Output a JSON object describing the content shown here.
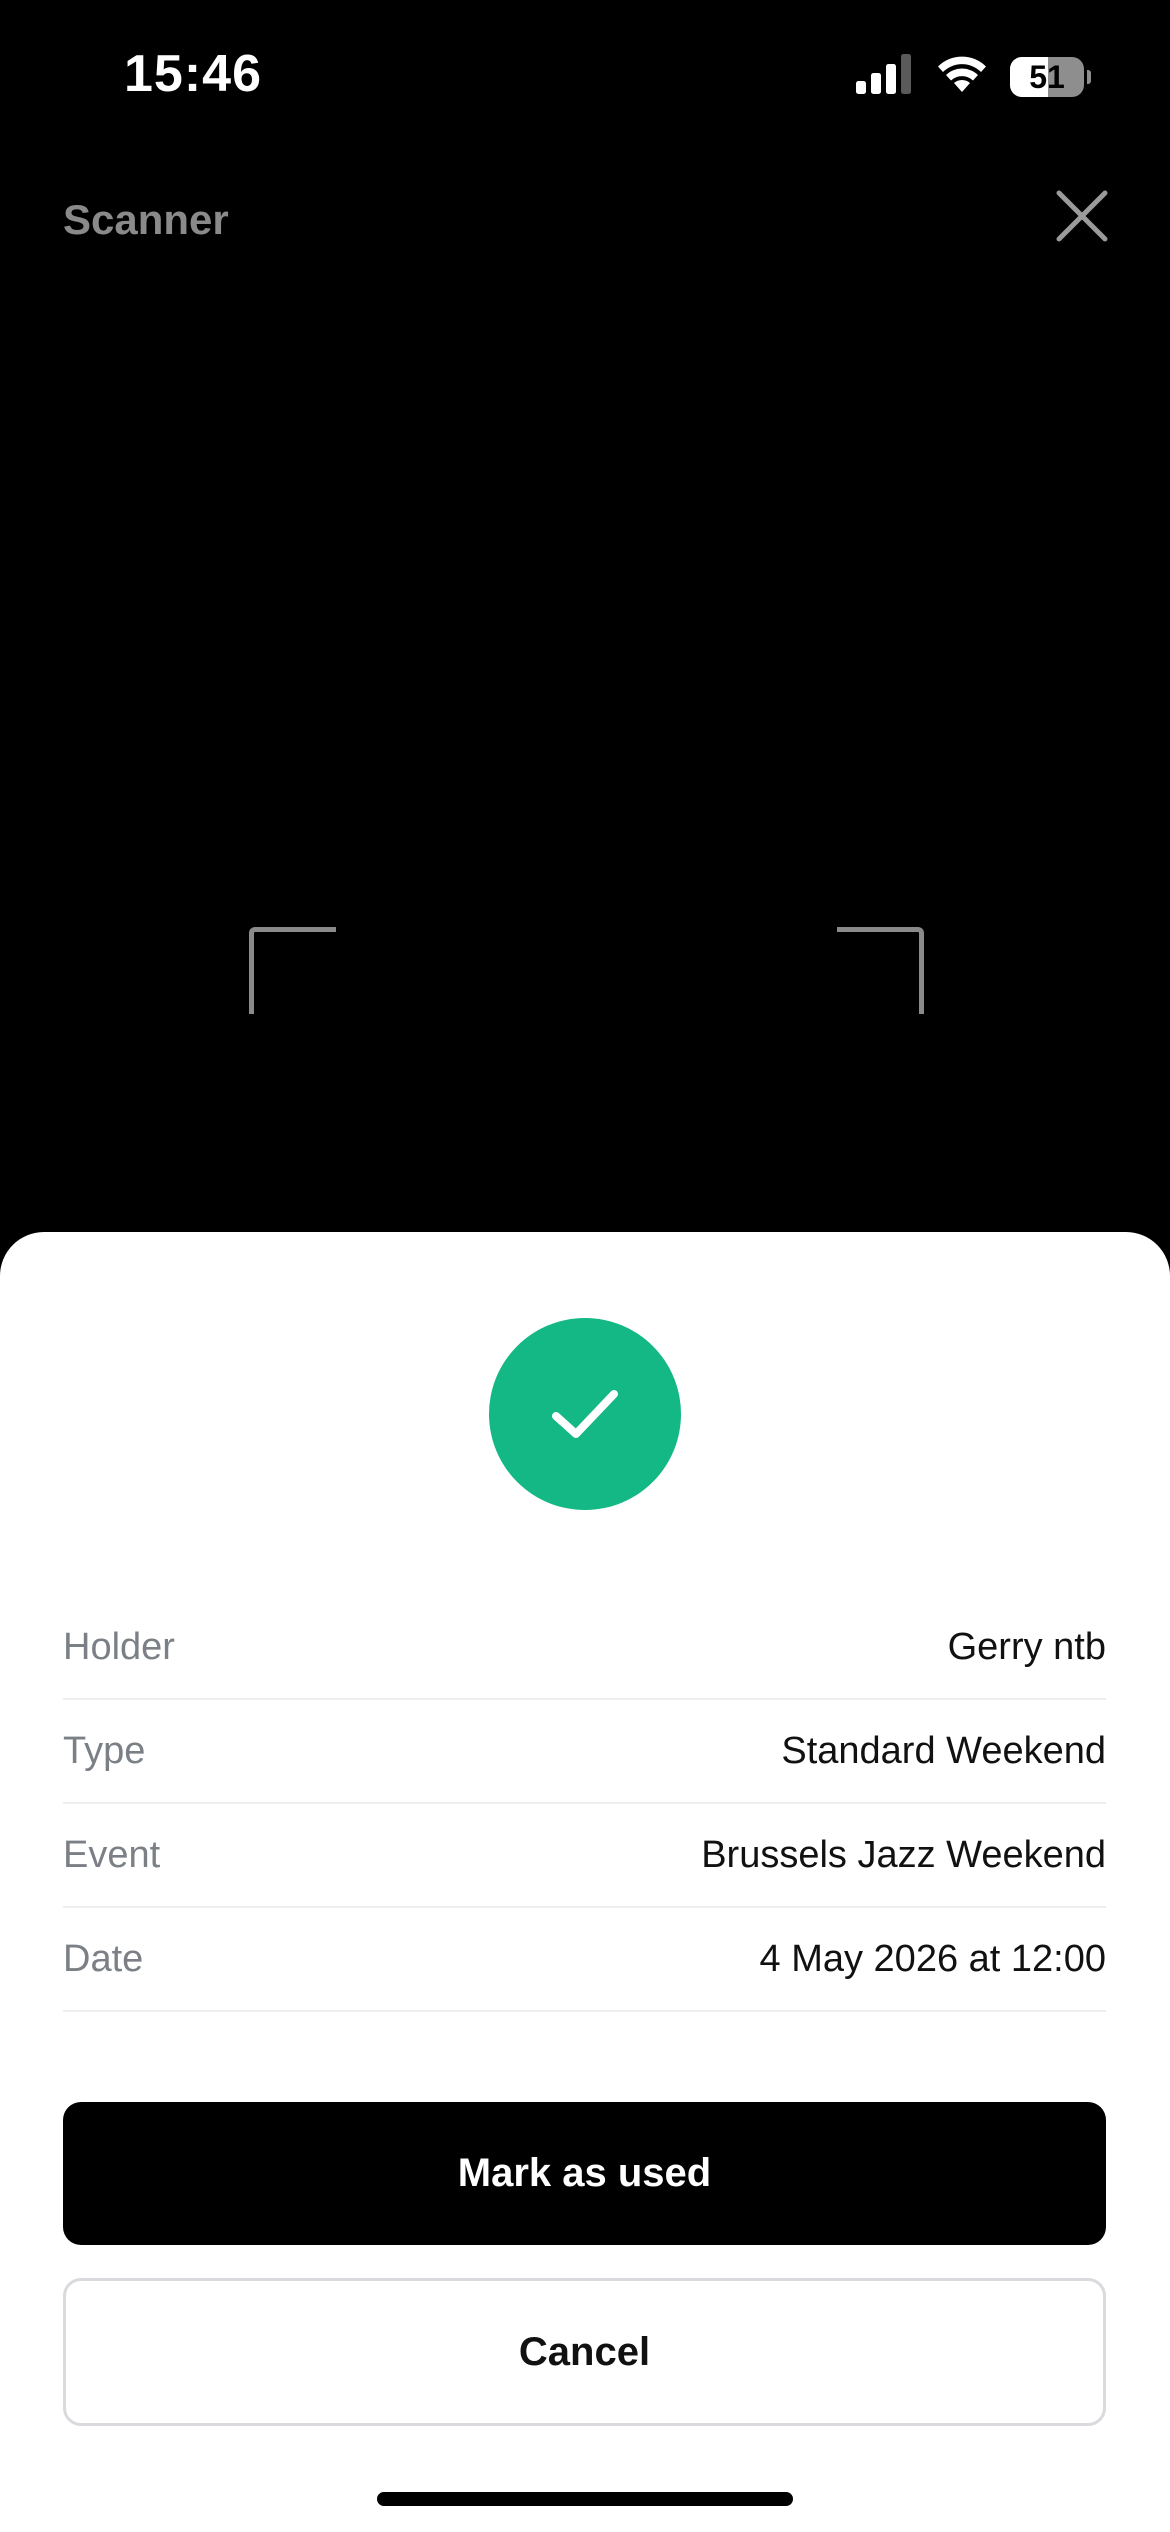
{
  "status_bar": {
    "time": "15:46",
    "signal_icon": "cellular-signal-icon",
    "wifi_icon": "wifi-icon",
    "battery_level": "51",
    "battery_fraction": 0.51
  },
  "header": {
    "title": "Scanner",
    "close_icon": "close-icon"
  },
  "result": {
    "status_icon": "checkmark-icon",
    "status_color": "#13b884",
    "details": [
      {
        "label": "Holder",
        "value": "Gerry ntb"
      },
      {
        "label": "Type",
        "value": "Standard Weekend"
      },
      {
        "label": "Event",
        "value": "Brussels Jazz Weekend"
      },
      {
        "label": "Date",
        "value": "4 May 2026 at 12:00"
      }
    ]
  },
  "actions": {
    "primary_label": "Mark as used",
    "secondary_label": "Cancel"
  }
}
